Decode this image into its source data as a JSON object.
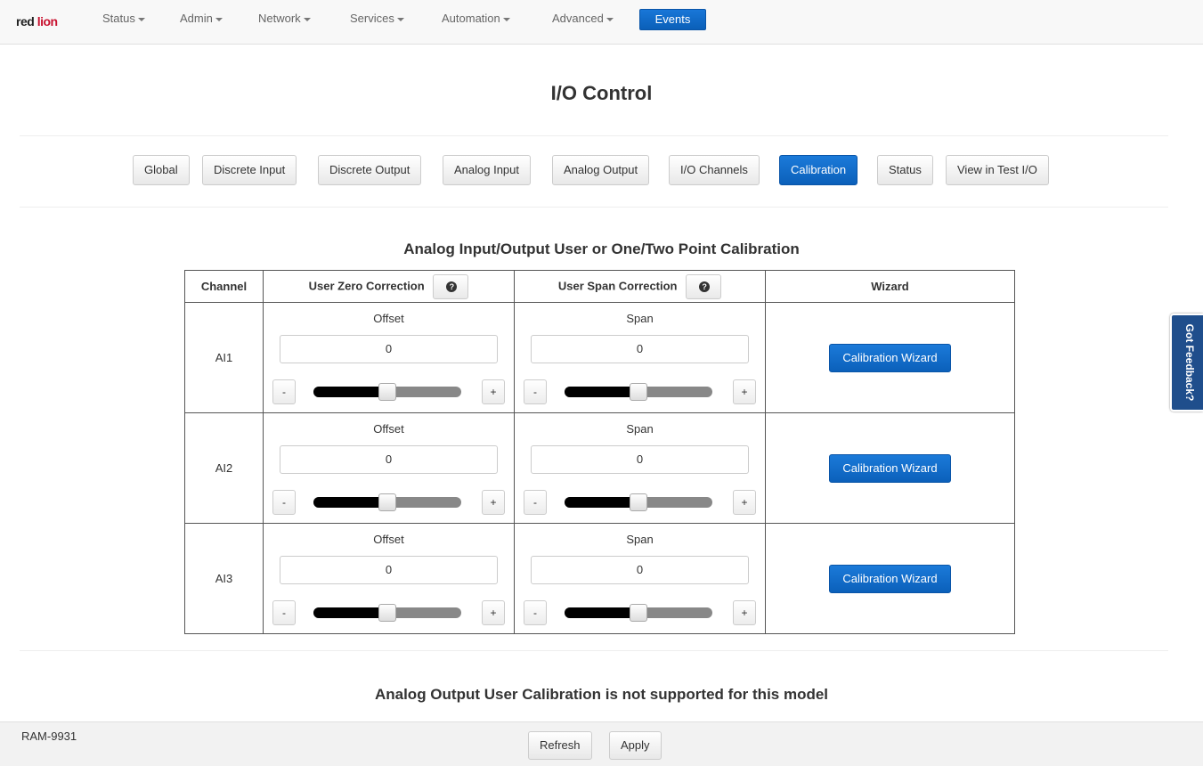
{
  "brand": {
    "logo_text_a": "red ",
    "logo_text_b": "lion"
  },
  "nav": {
    "items": [
      {
        "label": "Status"
      },
      {
        "label": "Admin"
      },
      {
        "label": "Network"
      },
      {
        "label": "Services"
      },
      {
        "label": "Automation"
      },
      {
        "label": "Advanced"
      }
    ],
    "events_label": "Events"
  },
  "page_title": "I/O Control",
  "tabs": [
    {
      "label": "Global",
      "active": false
    },
    {
      "label": "Discrete Input",
      "active": false
    },
    {
      "label": "Discrete Output",
      "active": false
    },
    {
      "label": "Analog Input",
      "active": false
    },
    {
      "label": "Analog Output",
      "active": false
    },
    {
      "label": "I/O Channels",
      "active": false
    },
    {
      "label": "Calibration",
      "active": true
    },
    {
      "label": "Status",
      "active": false
    },
    {
      "label": "View in Test I/O",
      "active": false
    }
  ],
  "calibration": {
    "title": "Analog Input/Output User or One/Two Point Calibration",
    "headers": {
      "channel": "Channel",
      "zero": "User Zero Correction",
      "span": "User Span Correction",
      "wizard": "Wizard"
    },
    "help_icon": "question-circle-icon",
    "rows": [
      {
        "channel": "AI1",
        "offset_label": "Offset",
        "offset_value": "0",
        "offset_slider": 0.5,
        "span_label": "Span",
        "span_value": "0",
        "span_slider": 0.5,
        "minus": "-",
        "plus": "+",
        "wizard": "Calibration Wizard"
      },
      {
        "channel": "AI2",
        "offset_label": "Offset",
        "offset_value": "0",
        "offset_slider": 0.5,
        "span_label": "Span",
        "span_value": "0",
        "span_slider": 0.5,
        "minus": "-",
        "plus": "+",
        "wizard": "Calibration Wizard"
      },
      {
        "channel": "AI3",
        "offset_label": "Offset",
        "offset_value": "0",
        "offset_slider": 0.5,
        "span_label": "Span",
        "span_value": "0",
        "span_slider": 0.5,
        "minus": "-",
        "plus": "+",
        "wizard": "Calibration Wizard"
      }
    ]
  },
  "output_note": "Analog Output User Calibration is not supported for this model",
  "feedback_label": "Got Feedback?",
  "footer": {
    "model": "RAM-9931",
    "refresh": "Refresh",
    "apply": "Apply"
  },
  "colors": {
    "accent": "#0b60ba",
    "feedback_bg": "#1f4e8c"
  }
}
